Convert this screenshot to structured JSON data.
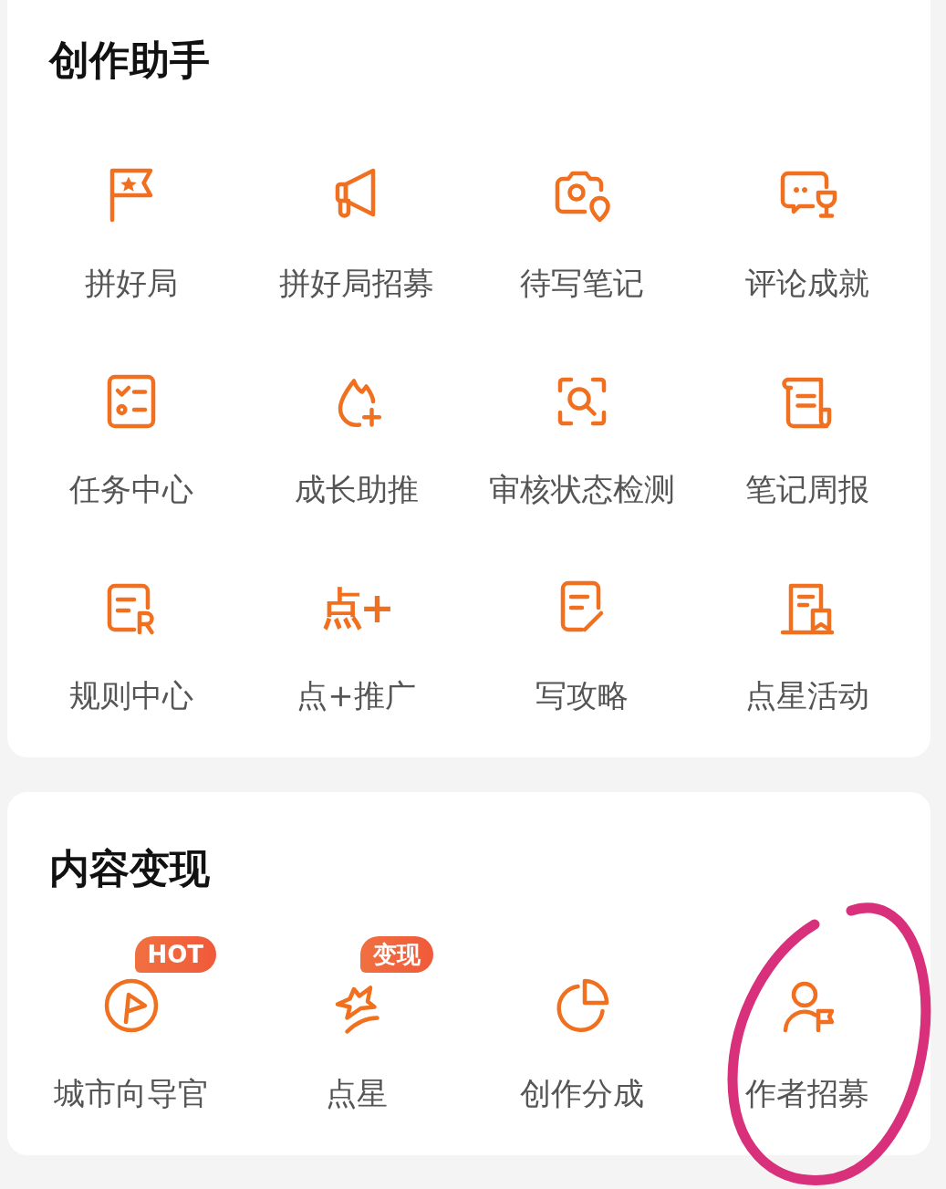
{
  "sections": [
    {
      "title": "创作助手",
      "items": [
        {
          "label": "拼好局",
          "circled": false
        },
        {
          "label": "拼好局招募",
          "circled": false
        },
        {
          "label": "待写笔记",
          "circled": false
        },
        {
          "label": "评论成就",
          "circled": false
        },
        {
          "label": "任务中心",
          "circled": false
        },
        {
          "label": "成长助推",
          "circled": false
        },
        {
          "label": "审核状态检测",
          "circled": false
        },
        {
          "label": "笔记周报",
          "circled": false
        },
        {
          "label": "规则中心",
          "circled": false
        },
        {
          "label": "点+推广",
          "glyph": "点+",
          "circled": false
        },
        {
          "label": "写攻略",
          "circled": false
        },
        {
          "label": "点星活动",
          "circled": false
        }
      ]
    },
    {
      "title": "内容变现",
      "items": [
        {
          "label": "城市向导官",
          "badge": "HOT",
          "circled": false
        },
        {
          "label": "点星",
          "badge": "变现",
          "circled": false
        },
        {
          "label": "创作分成",
          "circled": false
        },
        {
          "label": "作者招募",
          "circled": true
        }
      ]
    }
  ]
}
